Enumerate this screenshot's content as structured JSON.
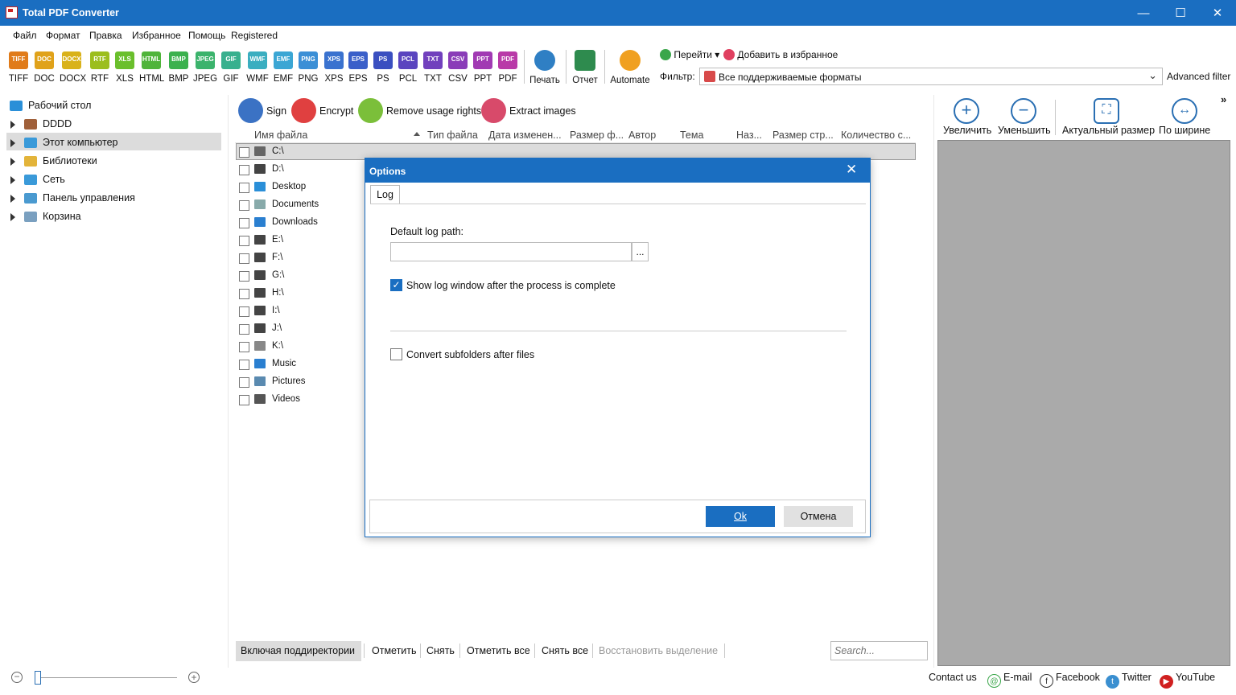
{
  "window": {
    "title": "Total PDF Converter",
    "min": "—",
    "max": "☐",
    "close": "✕"
  },
  "menu": [
    "Файл",
    "Формат",
    "Правка",
    "Избранное",
    "Помощь",
    "Registered"
  ],
  "formats": [
    {
      "label": "TIFF",
      "color": "#e07b1a"
    },
    {
      "label": "DOC",
      "color": "#e0a21a"
    },
    {
      "label": "DOCX",
      "color": "#d9b21a"
    },
    {
      "label": "RTF",
      "color": "#9cbe1e"
    },
    {
      "label": "XLS",
      "color": "#6abf2c"
    },
    {
      "label": "HTML",
      "color": "#4fb43a"
    },
    {
      "label": "BMP",
      "color": "#3bb14e"
    },
    {
      "label": "JPEG",
      "color": "#3bb36c"
    },
    {
      "label": "GIF",
      "color": "#38b08e"
    },
    {
      "label": "WMF",
      "color": "#3aaec0"
    },
    {
      "label": "EMF",
      "color": "#3ba6d4"
    },
    {
      "label": "PNG",
      "color": "#3b8fd6"
    },
    {
      "label": "XPS",
      "color": "#3a72cf"
    },
    {
      "label": "EPS",
      "color": "#3a5fc9"
    },
    {
      "label": "PS",
      "color": "#3a4fc0"
    },
    {
      "label": "PCL",
      "color": "#5a44bf"
    },
    {
      "label": "TXT",
      "color": "#7140bd"
    },
    {
      "label": "CSV",
      "color": "#8a3cb8"
    },
    {
      "label": "PPT",
      "color": "#a13ab3"
    },
    {
      "label": "PDF",
      "color": "#b93aa8"
    }
  ],
  "toolbar": {
    "print": "Печать",
    "report": "Отчет",
    "automate": "Automate",
    "goto": "Перейти",
    "add_fav": "Добавить в избранное",
    "filter_label": "Фильтр:",
    "filter_value": "Все поддерживаемые форматы",
    "advanced_filter": "Advanced filter"
  },
  "tree": [
    {
      "label": "Рабочий стол",
      "color": "#2a8fd8"
    },
    {
      "label": "DDDD",
      "color": "#a0603a"
    },
    {
      "label": "Этот компьютер",
      "color": "#3a9ad9"
    },
    {
      "label": "Библиотеки",
      "color": "#e3b43a"
    },
    {
      "label": "Сеть",
      "color": "#3a9ad9"
    },
    {
      "label": "Панель управления",
      "color": "#4a9ad0"
    },
    {
      "label": "Корзина",
      "color": "#7aa0c0"
    }
  ],
  "actions": [
    {
      "label": "Sign",
      "color": "#3b72c4"
    },
    {
      "label": "Encrypt",
      "color": "#e04040"
    },
    {
      "label": "Remove usage rights",
      "color": "#7bbf3a"
    },
    {
      "label": "Extract images",
      "color": "#d84a6a"
    }
  ],
  "columns": [
    "Имя файла",
    "Тип файла",
    "Дата изменен...",
    "Размер ф...",
    "Автор",
    "Тема",
    "Наз...",
    "Размер стр...",
    "Количество с..."
  ],
  "files": [
    {
      "name": "C:\\",
      "color": "#666"
    },
    {
      "name": "D:\\",
      "color": "#444"
    },
    {
      "name": "Desktop",
      "color": "#2a8fd8"
    },
    {
      "name": "Documents",
      "color": "#8aa"
    },
    {
      "name": "Downloads",
      "color": "#2a7fd0"
    },
    {
      "name": "E:\\",
      "color": "#444"
    },
    {
      "name": "F:\\",
      "color": "#444"
    },
    {
      "name": "G:\\",
      "color": "#444"
    },
    {
      "name": "H:\\",
      "color": "#444"
    },
    {
      "name": "I:\\",
      "color": "#444"
    },
    {
      "name": "J:\\",
      "color": "#444"
    },
    {
      "name": "K:\\",
      "color": "#888"
    },
    {
      "name": "Music",
      "color": "#2a7fd0"
    },
    {
      "name": "Pictures",
      "color": "#5a8ab0"
    },
    {
      "name": "Videos",
      "color": "#555"
    }
  ],
  "bottom": {
    "include_sub": "Включая поддиректории",
    "mark": "Отметить",
    "unmark": "Снять",
    "mark_all": "Отметить все",
    "unmark_all": "Снять все",
    "restore": "Восстановить выделение",
    "search_placeholder": "Search..."
  },
  "preview": {
    "zoom_in": "Увеличить",
    "zoom_out": "Уменьшить",
    "actual": "Актуальный размер",
    "fit_width": "По ширине",
    "more": "»"
  },
  "dialog": {
    "title": "Options",
    "tab": "Log",
    "log_path_label": "Default log path:",
    "log_path_value": "",
    "browse": "...",
    "show_log": "Show log window after the process is complete",
    "show_log_checked": true,
    "convert_sub": "Convert subfolders after files",
    "convert_sub_checked": false,
    "ok": "Ok",
    "cancel": "Отмена"
  },
  "footer": {
    "contact": "Contact us",
    "email": "E-mail",
    "facebook": "Facebook",
    "twitter": "Twitter",
    "youtube": "YouTube"
  }
}
